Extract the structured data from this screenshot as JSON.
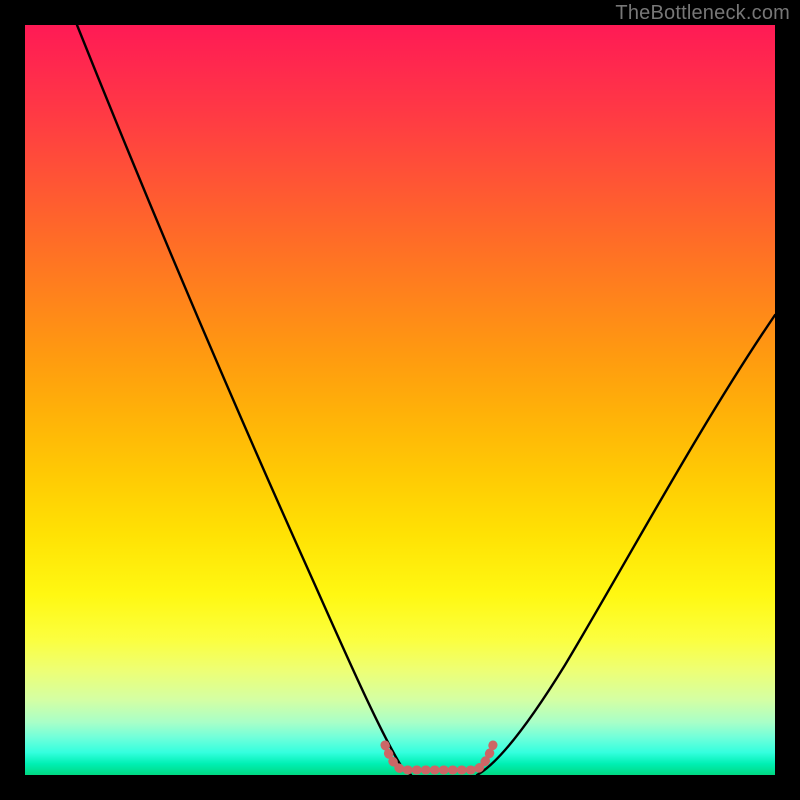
{
  "watermark": "TheBottleneck.com",
  "colors": {
    "background": "#000000",
    "curve": "#000000",
    "bracket": "#cc6666"
  },
  "chart_data": {
    "type": "line",
    "title": "",
    "xlabel": "",
    "ylabel": "",
    "xlim": [
      0,
      100
    ],
    "ylim": [
      0,
      100
    ],
    "series": [
      {
        "name": "v-curve-left",
        "x": [
          7,
          12,
          17,
          22,
          27,
          32,
          37,
          42,
          46,
          49,
          51
        ],
        "values": [
          100,
          88,
          76,
          64,
          52,
          40,
          28,
          16,
          6,
          1,
          0
        ]
      },
      {
        "name": "v-curve-right",
        "x": [
          60,
          63,
          67,
          72,
          77,
          83,
          89,
          95,
          100
        ],
        "values": [
          0,
          1,
          5,
          12,
          20,
          30,
          41,
          52,
          61
        ]
      },
      {
        "name": "bracket",
        "x": [
          48,
          49,
          50,
          54,
          58,
          60,
          61,
          62
        ],
        "values": [
          4,
          1.5,
          0.5,
          0.5,
          0.5,
          0.5,
          1.5,
          4
        ]
      }
    ],
    "legend": false,
    "grid": false
  }
}
